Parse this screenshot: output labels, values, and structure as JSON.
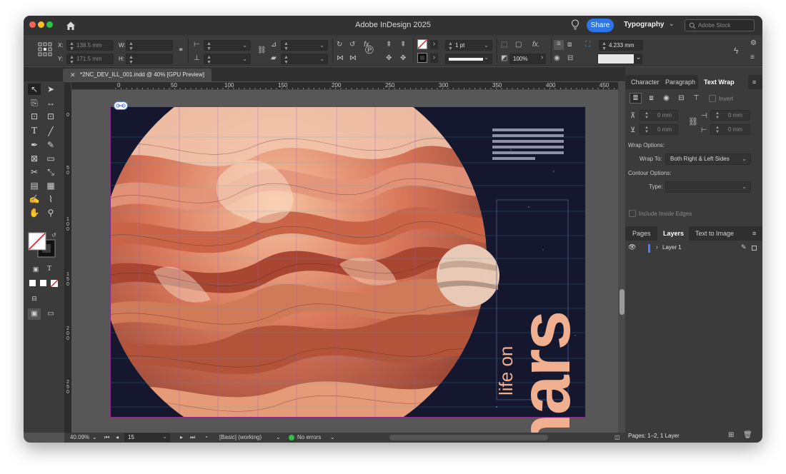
{
  "app": {
    "title": "Adobe InDesign 2025",
    "share_label": "Share",
    "workspace_label": "Typography",
    "stock_placeholder": "Adobe Stock"
  },
  "control": {
    "x_label": "X:",
    "x_value": "138.5 mm",
    "y_label": "Y:",
    "y_value": "171.5 mm",
    "w_label": "W:",
    "h_label": "H:",
    "stroke_weight": "1 pt",
    "opacity": "100%",
    "dimension": "4.233 mm"
  },
  "document": {
    "tab_title": "*2NC_DEV_ILL_001.indd @ 40% [GPU Preview]"
  },
  "ruler": {
    "h_ticks": [
      "0",
      "50",
      "100",
      "150",
      "200",
      "250",
      "300",
      "350",
      "400",
      "450"
    ],
    "v_ticks": [
      "0",
      "50",
      "100",
      "150",
      "200",
      "250"
    ]
  },
  "artwork": {
    "title_word": "mars",
    "subtitle": "life on",
    "colors": {
      "page_bg": "#15172f",
      "title_color": "#f0b090",
      "planet_base": "#d07050"
    }
  },
  "status": {
    "zoom": "40.09%",
    "page": "15",
    "preflight_profile": "[Basic] (working)",
    "errors": "No errors"
  },
  "panel": {
    "tabs": [
      "Character",
      "Paragraph",
      "Text Wrap"
    ],
    "invert_label": "Invert",
    "offset_top": "0 mm",
    "offset_bottom": "0 mm",
    "offset_left": "0 mm",
    "offset_right": "0 mm",
    "wrap_options_label": "Wrap Options:",
    "wrap_to_label": "Wrap To:",
    "wrap_to_value": "Both Right & Left Sides",
    "contour_options_label": "Contour Options:",
    "type_label": "Type:",
    "include_edges_label": "Include Inside Edges"
  },
  "layers_panel": {
    "tabs": [
      "Pages",
      "Layers",
      "Text to Image"
    ],
    "layer_name": "Layer 1",
    "footer": "Pages: 1–2, 1 Layer"
  }
}
